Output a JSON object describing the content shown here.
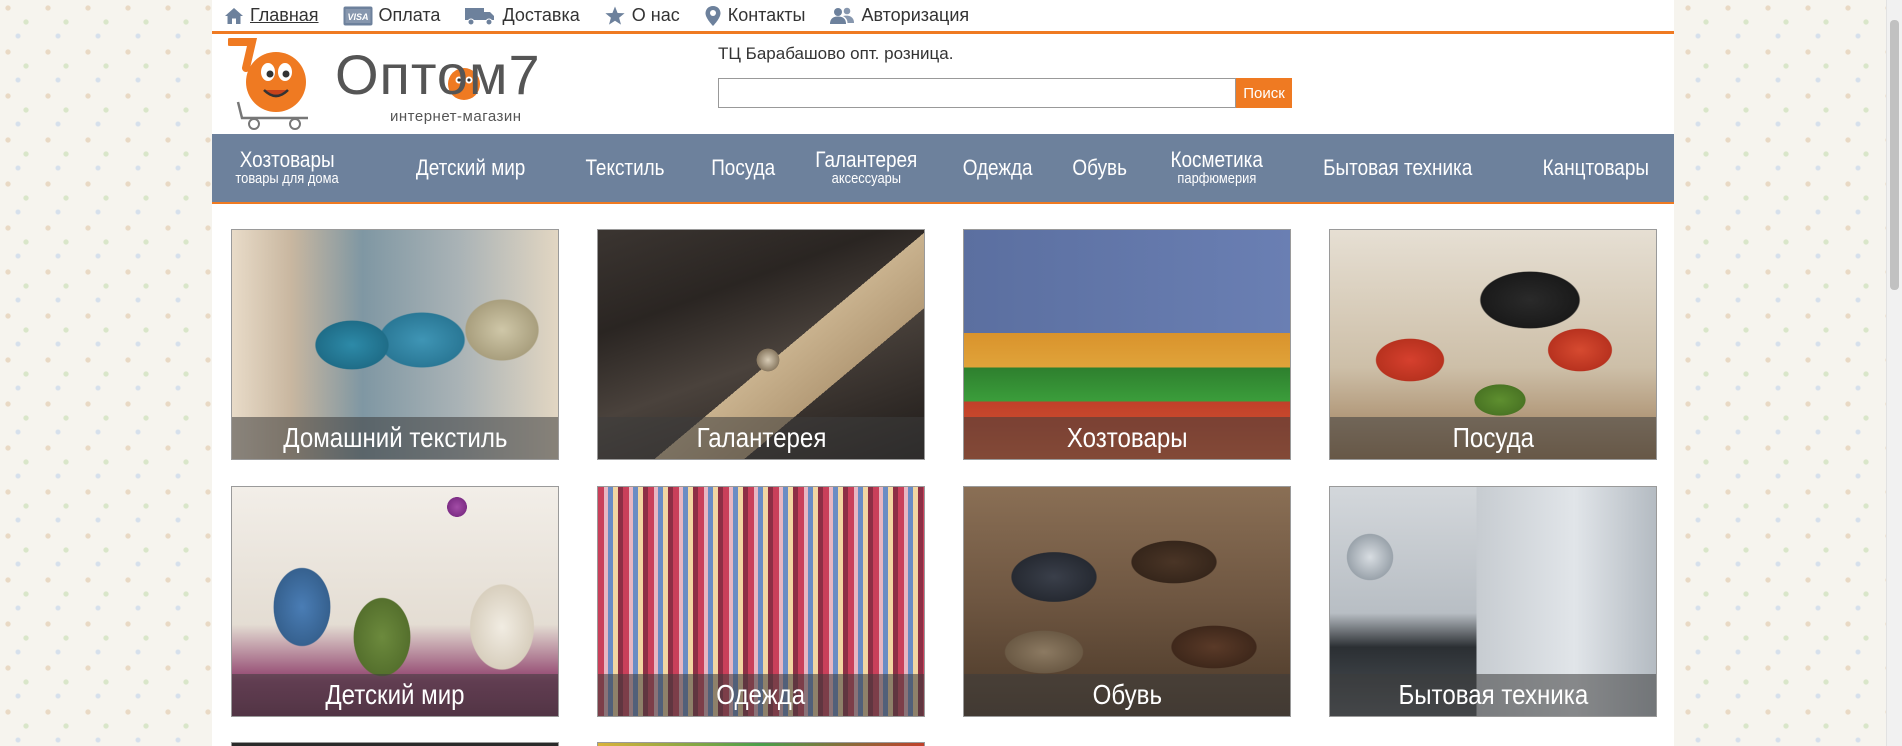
{
  "topnav": {
    "items": [
      {
        "label": "Главная",
        "icon": "home-icon"
      },
      {
        "label": "Оплата",
        "icon": "visa-card-icon"
      },
      {
        "label": "Доставка",
        "icon": "truck-icon"
      },
      {
        "label": "О нас",
        "icon": "star-icon"
      },
      {
        "label": "Контакты",
        "icon": "map-pin-icon"
      },
      {
        "label": "Авторизация",
        "icon": "users-icon"
      }
    ],
    "card_text": "VISA"
  },
  "header": {
    "logo_text": "Оптом7",
    "logo_tagline": "интернет-магазин",
    "address": "ТЦ Барабашово опт. розница.",
    "search": {
      "value": "",
      "placeholder": "",
      "button": "Поиск"
    }
  },
  "menu": {
    "items": [
      {
        "label": "Хозтовары",
        "sub": "товары для дома"
      },
      {
        "label": "Детский мир",
        "sub": ""
      },
      {
        "label": "Текстиль",
        "sub": ""
      },
      {
        "label": "Посуда",
        "sub": ""
      },
      {
        "label": "Галантерея",
        "sub": "аксессуары"
      },
      {
        "label": "Одежда",
        "sub": ""
      },
      {
        "label": "Обувь",
        "sub": ""
      },
      {
        "label": "Косметика",
        "sub": "парфюмерия"
      },
      {
        "label": "Бытовая техника",
        "sub": ""
      },
      {
        "label": "Канцтовары",
        "sub": ""
      }
    ]
  },
  "categories": [
    {
      "label": "Домашний текстиль"
    },
    {
      "label": "Галантерея"
    },
    {
      "label": "Хозтовары"
    },
    {
      "label": "Посуда"
    },
    {
      "label": "Детский мир"
    },
    {
      "label": "Одежда"
    },
    {
      "label": "Обувь"
    },
    {
      "label": "Бытовая техника"
    }
  ],
  "colors": {
    "accent": "#ef7a22",
    "menu_bg": "#6d819c"
  }
}
